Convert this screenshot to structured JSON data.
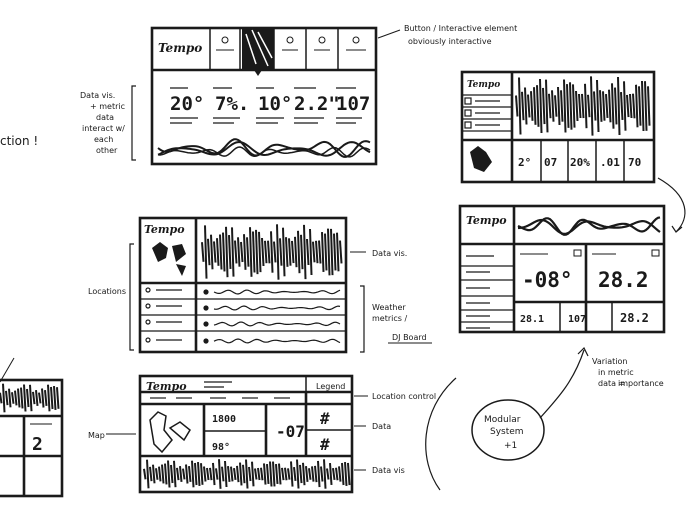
{
  "notes": {
    "button": "Button / Interactive element",
    "obvious": "obviously interactive",
    "data_vis_1": "Data vis.",
    "data_vis_2": "+ metric",
    "data_vis_3": "data",
    "data_vis_4": "interact w/",
    "data_vis_5": "each",
    "data_vis_6": "other",
    "action": "ction !",
    "data_vis_right": "Data vis.",
    "locations": "Locations",
    "weather_1": "Weather",
    "weather_2": "metrics /",
    "weather_3": "DJ Board",
    "location_control": "Location control",
    "data": "Data",
    "data_vis_bottom": "Data vis",
    "map": "Map",
    "variation_1": "Variation",
    "variation_2": "in metric",
    "variation_3": "data =",
    "variation_4": "importance",
    "modular_1": "Modular",
    "modular_2": "System",
    "modular_3": "+1"
  },
  "sketch1": {
    "logo": "Tempo",
    "metrics": [
      "20°",
      "7%.",
      "10°",
      "2.2\"",
      "107"
    ]
  },
  "sketch2": {
    "logo": "Tempo",
    "metrics": [
      "2°",
      "07",
      "20%",
      ".01",
      "70"
    ]
  },
  "sketch3": {
    "logo": "Tempo"
  },
  "sketch4": {
    "logo": "Tempo",
    "big_left": "-08°",
    "big_right": "28.2",
    "small": [
      "28.1",
      "107",
      "28.2"
    ]
  },
  "sketch5": {
    "logo": "Tempo",
    "legend": "Legend",
    "val_a": "1800",
    "val_b": "98°",
    "val_c": "-07",
    "hash1": "#",
    "hash2": "#"
  },
  "sketch6": {
    "value": "2"
  }
}
